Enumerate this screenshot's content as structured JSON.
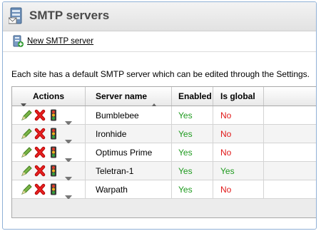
{
  "header": {
    "title": "SMTP servers",
    "icon": "smtp-server-icon"
  },
  "toolbar": {
    "new_label": "New SMTP server",
    "new_icon": "new-server-icon"
  },
  "info_text": "Each site has a default SMTP server which can be edited through the Settings.",
  "grid": {
    "columns": {
      "actions": "Actions",
      "server_name": "Server name",
      "enabled": "Enabled",
      "is_global": "Is global"
    },
    "sort_column": "server_name",
    "sort_direction": "ascending",
    "rows": [
      {
        "server_name": "Bumblebee",
        "enabled": "Yes",
        "is_global": "No"
      },
      {
        "server_name": "Ironhide",
        "enabled": "Yes",
        "is_global": "No"
      },
      {
        "server_name": "Optimus Prime",
        "enabled": "Yes",
        "is_global": "No"
      },
      {
        "server_name": "Teletran-1",
        "enabled": "Yes",
        "is_global": "Yes"
      },
      {
        "server_name": "Warpath",
        "enabled": "Yes",
        "is_global": "No"
      }
    ]
  },
  "colors": {
    "yes": "#1e9a1e",
    "no": "#e01818",
    "border": "#8fb0d6"
  }
}
